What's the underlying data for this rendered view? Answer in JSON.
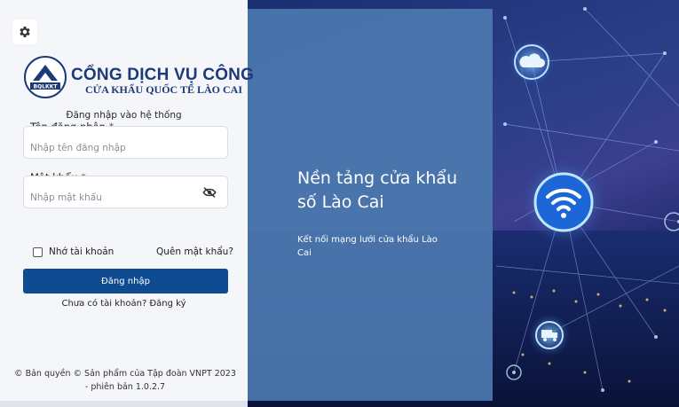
{
  "brand": {
    "title": "CỔNG DỊCH VỤ CÔNG",
    "subtitle": "CỬA KHẨU QUỐC TẾ LÀO CAI",
    "logo_text": "BQLKKT"
  },
  "login": {
    "heading": "Đăng nhập vào hệ thống",
    "username_label": "Tên đăng nhập",
    "username_placeholder": "Nhập tên đăng nhập",
    "username_value": "",
    "password_label": "Mật khẩu",
    "password_placeholder": "Nhập mật khẩu",
    "password_value": "",
    "required_mark": "*",
    "remember_label": "Nhớ tài khoản",
    "remember_checked": false,
    "forgot_label": "Quên mật khẩu?",
    "submit_label": "Đăng nhập",
    "register_label": "Chưa có tài khoản? Đăng ký"
  },
  "footer": {
    "copyright": "© Bản quyền © Sản phẩm của Tập đoàn VNPT 2023 - phiên bản 1.0.2.7"
  },
  "hero": {
    "title": "Nền tảng cửa khẩu số Lào Cai",
    "subtitle": "Kết nối mạng lưới cửa khẩu Lào Cai"
  },
  "icons": [
    "gear-icon",
    "eye-off-icon",
    "cloud-icon",
    "wifi-icon",
    "truck-icon"
  ],
  "colors": {
    "primary": "#0f4b91",
    "brand_text": "#1d3a78",
    "panel_bg": "#f4f6fa",
    "overlay": "#4c78af"
  }
}
